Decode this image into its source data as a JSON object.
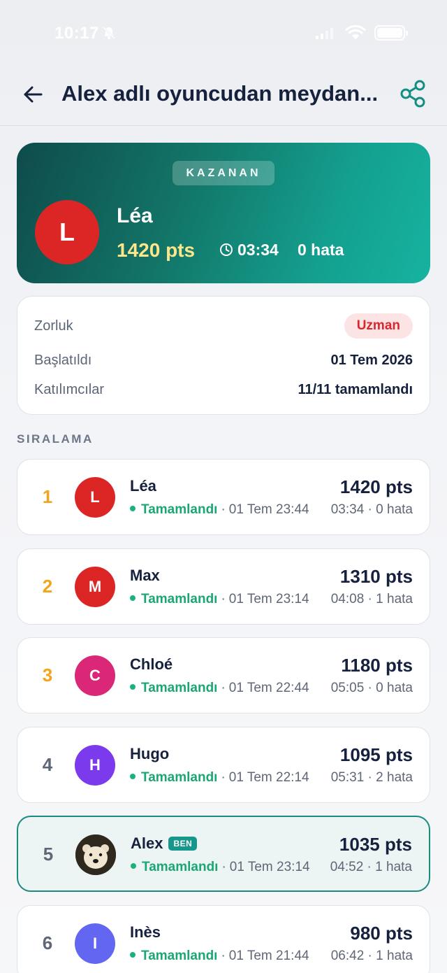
{
  "status_bar": {
    "time": "10:17"
  },
  "nav": {
    "title": "Alex adlı oyuncudan meydan..."
  },
  "winner": {
    "badge": "KAZANAN",
    "initial": "L",
    "name": "Léa",
    "points": "1420 pts",
    "time": "03:34",
    "errors": "0 hata",
    "avatar_color": "#dc2626"
  },
  "info": {
    "difficulty_label": "Zorluk",
    "difficulty_value": "Uzman",
    "started_label": "Başlatıldı",
    "started_value": "01 Tem 2026",
    "participants_label": "Katılımcılar",
    "participants_value": "11/11 tamamlandı"
  },
  "ranking": {
    "heading": "SIRALAMA",
    "me_badge": "BEN",
    "items": [
      {
        "rank": "1",
        "initial": "L",
        "name": "Léa",
        "status": "Tamamlandı",
        "date": "01 Tem 23:44",
        "points": "1420 pts",
        "time_errors": "03:34 · 0 hata",
        "avatar_color": "#dc2626",
        "medal": true,
        "me": false
      },
      {
        "rank": "2",
        "initial": "M",
        "name": "Max",
        "status": "Tamamlandı",
        "date": "01 Tem 23:14",
        "points": "1310 pts",
        "time_errors": "04:08 · 1 hata",
        "avatar_color": "#dc2626",
        "medal": true,
        "me": false
      },
      {
        "rank": "3",
        "initial": "C",
        "name": "Chloé",
        "status": "Tamamlandı",
        "date": "01 Tem 22:44",
        "points": "1180 pts",
        "time_errors": "05:05 · 0 hata",
        "avatar_color": "#db2777",
        "medal": true,
        "me": false
      },
      {
        "rank": "4",
        "initial": "H",
        "name": "Hugo",
        "status": "Tamamlandı",
        "date": "01 Tem 22:14",
        "points": "1095 pts",
        "time_errors": "05:31 · 2 hata",
        "avatar_color": "#7c3aed",
        "medal": false,
        "me": false
      },
      {
        "rank": "5",
        "initial": "",
        "name": "Alex",
        "status": "Tamamlandı",
        "date": "01 Tem 23:14",
        "points": "1035 pts",
        "time_errors": "04:52 · 1 hata",
        "avatar_color": "#3a3226",
        "medal": false,
        "me": true
      },
      {
        "rank": "6",
        "initial": "I",
        "name": "Inès",
        "status": "Tamamlandı",
        "date": "01 Tem 21:44",
        "points": "980 pts",
        "time_errors": "06:42 · 1 hata",
        "avatar_color": "#6366f1",
        "medal": false,
        "me": false
      }
    ]
  }
}
